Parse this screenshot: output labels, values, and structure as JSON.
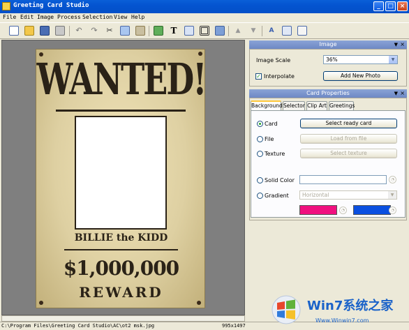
{
  "window": {
    "title": "Greeting Card Studio",
    "min": "_",
    "max": "□",
    "close": "×"
  },
  "menu": [
    "File",
    "Edit",
    "Image",
    "Process",
    "Selection",
    "View",
    "Help"
  ],
  "toolbar": {
    "icons": [
      "new-icon",
      "open-icon",
      "save-icon",
      "print-icon",
      "undo-icon",
      "redo-icon",
      "cut-icon",
      "copy-icon",
      "paste-icon",
      "image-icon",
      "text-icon",
      "layout-icon",
      "frame-icon",
      "effects-icon",
      "move-up-icon",
      "move-down-icon",
      "text-effect-icon",
      "resize-icon",
      "properties-icon"
    ],
    "text_button": "T"
  },
  "poster": {
    "headline": "WANTED!",
    "name": "BILLIE the KIDD",
    "amount": "$1,000,000",
    "reward": "REWARD",
    "colors": {
      "paper": "#e7d9ad",
      "ink": "#2a2217"
    }
  },
  "status": {
    "path": "C:\\Program Files\\Greeting Card Studio\\AC\\ot2 msk.jpg",
    "size": "995x1497"
  },
  "image_panel": {
    "title": "Image",
    "scale_label": "Image Scale",
    "scale_value": "36%",
    "interpolate_label": "Interpolate",
    "interpolate_checked": true,
    "add_photo": "Add New Photo"
  },
  "card_panel": {
    "title": "Card Properties",
    "tabs": [
      "Background",
      "Selector",
      "Clip Art",
      "Greetings"
    ],
    "active_tab": "Background",
    "card_label": "Card",
    "card_button": "Select ready card",
    "file_label": "File",
    "file_button": "Load from file",
    "texture_label": "Texture",
    "texture_button": "Select texture",
    "solid_label": "Solid Color",
    "gradient_label": "Gradient",
    "gradient_value": "Horizontal",
    "gradient_colors": [
      "#f0107f",
      "#0a4fe0"
    ]
  },
  "watermark": {
    "text": "Win7系统之家",
    "url": "Www.Winwin7.com"
  }
}
